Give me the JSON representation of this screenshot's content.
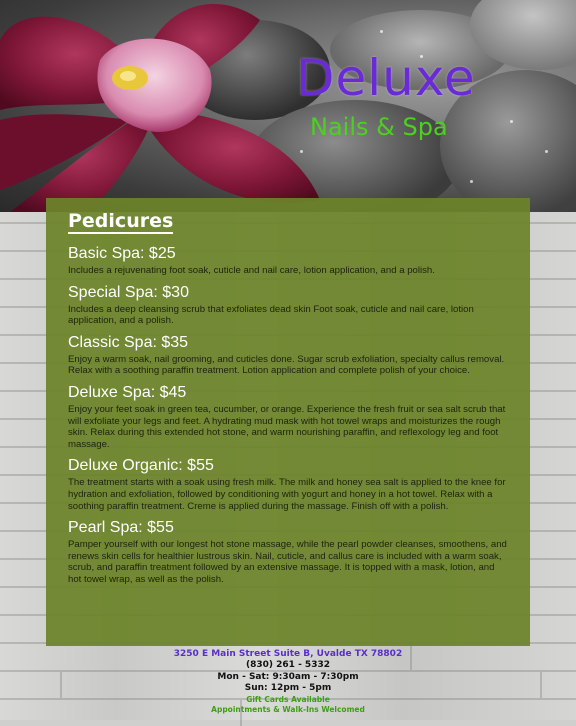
{
  "brand": {
    "name": "Deluxe",
    "tagline": "Nails & Spa"
  },
  "menu": {
    "title": "Pedicures",
    "items": [
      {
        "name": "Basic Spa: $25",
        "description": "Includes a rejuvenating foot soak, cuticle and nail care, lotion application, and a polish."
      },
      {
        "name": "Special Spa: $30",
        "description": "Includes a deep cleansing scrub that exfoliates dead skin  Foot soak, cuticle and nail care, lotion application, and a polish."
      },
      {
        "name": "Classic Spa: $35",
        "description": "Enjoy a warm soak, nail grooming, and cuticles done. Sugar scrub exfoliation, specialty callus removal. Relax with a soothing paraffin treatment. Lotion application and complete polish of your choice."
      },
      {
        "name": "Deluxe Spa: $45",
        "description": "Enjoy your feet soak in green tea, cucumber, or orange. Experience the fresh fruit or sea salt scrub that will exfoliate your legs and feet. A hydrating mud mask with hot towel wraps and moisturizes the rough skin. Relax during this extended hot stone, and warm nourishing paraffin, and reflexology leg and foot massage."
      },
      {
        "name": "Deluxe Organic: $55",
        "description": "The treatment starts with a soak using fresh milk. The milk and honey sea salt is applied to the knee for hydration and exfoliation, followed by conditioning with yogurt and honey in a hot towel. Relax with a soothing paraffin treatment. Creme is applied during the massage. Finish off with a polish."
      },
      {
        "name": "Pearl Spa: $55",
        "description": "Pamper yourself with our longest hot stone massage, while the pearl powder cleanses, smoothens, and renews skin cells for healthier lustrous skin. Nail, cuticle, and callus care is included with a warm soak, scrub, and paraffin treatment followed by an extensive massage. It is topped with a mask, lotion, and hot towel wrap, as well as the polish."
      }
    ]
  },
  "contact": {
    "address": "3250 E Main Street Suite B, Uvalde TX 78802",
    "phone": "(830) 261 - 5332",
    "hours_weekday": "Mon - Sat: 9:30am - 7:30pm",
    "hours_sunday": "Sun: 12pm - 5pm",
    "gift_cards": "Gift Cards Available",
    "appointments": "Appointments & Walk-Ins Welcomed"
  },
  "colors": {
    "brand_purple": "#6a2bd6",
    "brand_green": "#4cd11f",
    "panel_green": "#6c8329",
    "address_purple": "#5a2fc9"
  }
}
